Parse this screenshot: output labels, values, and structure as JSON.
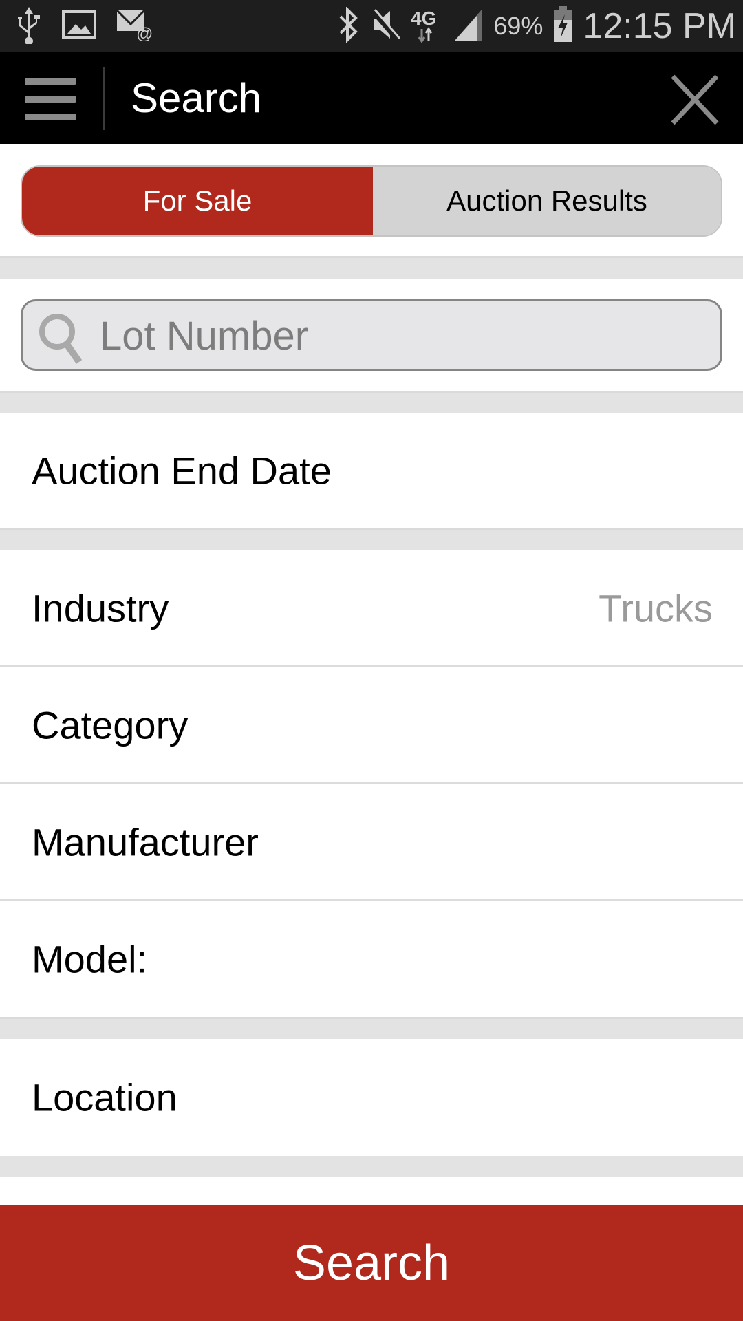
{
  "status_bar": {
    "left_icons": [
      "usb-icon",
      "image-icon",
      "email-icon"
    ],
    "right_icons": [
      "bluetooth-icon",
      "mute-icon",
      "4g-lte-icon",
      "signal-icon",
      "battery-charging-icon"
    ],
    "network_label": "4G",
    "battery_percent": "69%",
    "time": "12:15 PM"
  },
  "app_bar": {
    "menu_icon": "hamburger-menu-icon",
    "title": "Search",
    "close_icon": "close-icon"
  },
  "segmented_control": {
    "options": [
      {
        "label": "For Sale",
        "selected": true
      },
      {
        "label": "Auction Results",
        "selected": false
      }
    ]
  },
  "lot_search": {
    "icon": "search-icon",
    "placeholder": "Lot Number",
    "value": ""
  },
  "filters": {
    "auction_end_date": {
      "label": "Auction End Date",
      "value": ""
    },
    "industry": {
      "label": "Industry",
      "value": "Trucks"
    },
    "category": {
      "label": "Category",
      "value": ""
    },
    "manufacturer": {
      "label": "Manufacturer",
      "value": ""
    },
    "model": {
      "label": "Model:",
      "value": ""
    },
    "location": {
      "label": "Location",
      "value": ""
    }
  },
  "footer": {
    "search_button_label": "Search"
  },
  "colors": {
    "accent_red": "#b1291d",
    "app_bar_bg": "#000000",
    "status_bar_bg": "#1e1e1e",
    "section_gap": "#e3e3e3",
    "inactive_segment": "#d3d3d3",
    "value_text": "#9a9a9a"
  }
}
